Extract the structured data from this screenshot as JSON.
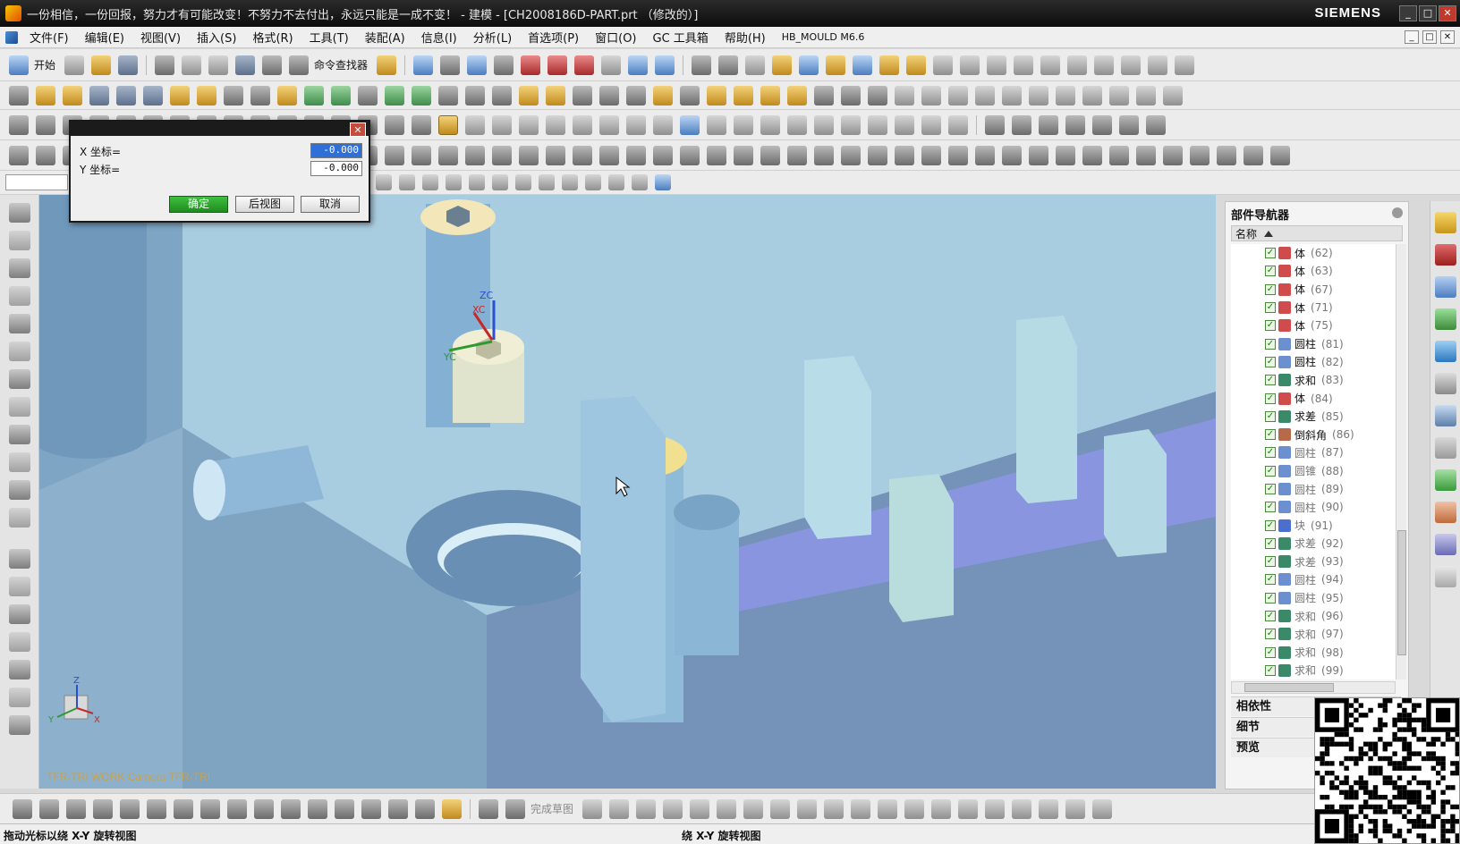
{
  "window": {
    "title": "一份相信，一份回报，努力才有可能改变！不努力不去付出，永远只能是一成不变！ - 建模 - [CH2008186D-PART.prt （修改的）]",
    "brand": "SIEMENS",
    "min_icon": "minimize-icon",
    "max_icon": "maximize-icon",
    "close_icon": "close-icon"
  },
  "menu": [
    "文件(F)",
    "编辑(E)",
    "视图(V)",
    "插入(S)",
    "格式(R)",
    "工具(T)",
    "装配(A)",
    "信息(I)",
    "分析(L)",
    "首选项(P)",
    "窗口(O)",
    "GC 工具箱",
    "帮助(H)",
    "HB_MOULD M6.6"
  ],
  "toolbar": {
    "start_label": "开始",
    "command_finder_label": "命令查找器",
    "sketch_finish_label": "完成草图"
  },
  "dialog": {
    "x_label": "X 坐标=",
    "y_label": "Y 坐标=",
    "x_value": "-0.000",
    "y_value": "-0.000",
    "ok_label": "确定",
    "back_label": "后视图",
    "cancel_label": "取消"
  },
  "viewport": {
    "caption": "TFR-TRI WORK Camera TFR-TRI",
    "axis_zc": "ZC",
    "axis_xc": "XC",
    "axis_yc": "YC",
    "triad_z": "Z",
    "triad_x": "X",
    "triad_y": "Y"
  },
  "navigator": {
    "title": "部件导航器",
    "column_name": "名称",
    "nodes": [
      {
        "name": "体",
        "id": "(62)",
        "icon": "body-icon",
        "color": "#d04b4b"
      },
      {
        "name": "体",
        "id": "(63)",
        "icon": "body-icon",
        "color": "#d04b4b"
      },
      {
        "name": "体",
        "id": "(67)",
        "icon": "body-icon",
        "color": "#d04b4b"
      },
      {
        "name": "体",
        "id": "(71)",
        "icon": "body-icon",
        "color": "#d04b4b"
      },
      {
        "name": "体",
        "id": "(75)",
        "icon": "body-icon",
        "color": "#d04b4b"
      },
      {
        "name": "圆柱",
        "id": "(81)",
        "icon": "cylinder-icon",
        "color": "#6b8fcf"
      },
      {
        "name": "圆柱",
        "id": "(82)",
        "icon": "cylinder-icon",
        "color": "#6b8fcf"
      },
      {
        "name": "求和",
        "id": "(83)",
        "icon": "unite-icon",
        "color": "#3a8a6a"
      },
      {
        "name": "体",
        "id": "(84)",
        "icon": "body-icon",
        "color": "#d04b4b"
      },
      {
        "name": "求差",
        "id": "(85)",
        "icon": "subtract-icon",
        "color": "#3a8a6a"
      },
      {
        "name": "倒斜角",
        "id": "(86)",
        "icon": "chamfer-icon",
        "color": "#b66a4a"
      },
      {
        "name": "圆柱",
        "id": "(87)",
        "icon": "cylinder-icon",
        "color": "#6b8fcf",
        "dim": true
      },
      {
        "name": "圆锥",
        "id": "(88)",
        "icon": "cone-icon",
        "color": "#6b8fcf",
        "dim": true
      },
      {
        "name": "圆柱",
        "id": "(89)",
        "icon": "cylinder-icon",
        "color": "#6b8fcf",
        "dim": true
      },
      {
        "name": "圆柱",
        "id": "(90)",
        "icon": "cylinder-icon",
        "color": "#6b8fcf",
        "dim": true
      },
      {
        "name": "块",
        "id": "(91)",
        "icon": "block-icon",
        "color": "#4a6fcf",
        "dim": true
      },
      {
        "name": "求差",
        "id": "(92)",
        "icon": "subtract-icon",
        "color": "#3a8a6a",
        "dim": true
      },
      {
        "name": "求差",
        "id": "(93)",
        "icon": "subtract-icon",
        "color": "#3a8a6a",
        "dim": true
      },
      {
        "name": "圆柱",
        "id": "(94)",
        "icon": "cylinder-icon",
        "color": "#6b8fcf",
        "dim": true
      },
      {
        "name": "圆柱",
        "id": "(95)",
        "icon": "cylinder-icon",
        "color": "#6b8fcf",
        "dim": true
      },
      {
        "name": "求和",
        "id": "(96)",
        "icon": "unite-icon",
        "color": "#3a8a6a",
        "dim": true
      },
      {
        "name": "求和",
        "id": "(97)",
        "icon": "unite-icon",
        "color": "#3a8a6a",
        "dim": true
      },
      {
        "name": "求和",
        "id": "(98)",
        "icon": "unite-icon",
        "color": "#3a8a6a",
        "dim": true
      },
      {
        "name": "求和",
        "id": "(99)",
        "icon": "unite-icon",
        "color": "#3a8a6a",
        "dim": true
      }
    ],
    "sections": [
      "相依性",
      "细节",
      "预览"
    ]
  },
  "status": {
    "left": "拖动光标以绕 X-Y 旋转视图",
    "center": "绕 X-Y 旋转视图"
  }
}
